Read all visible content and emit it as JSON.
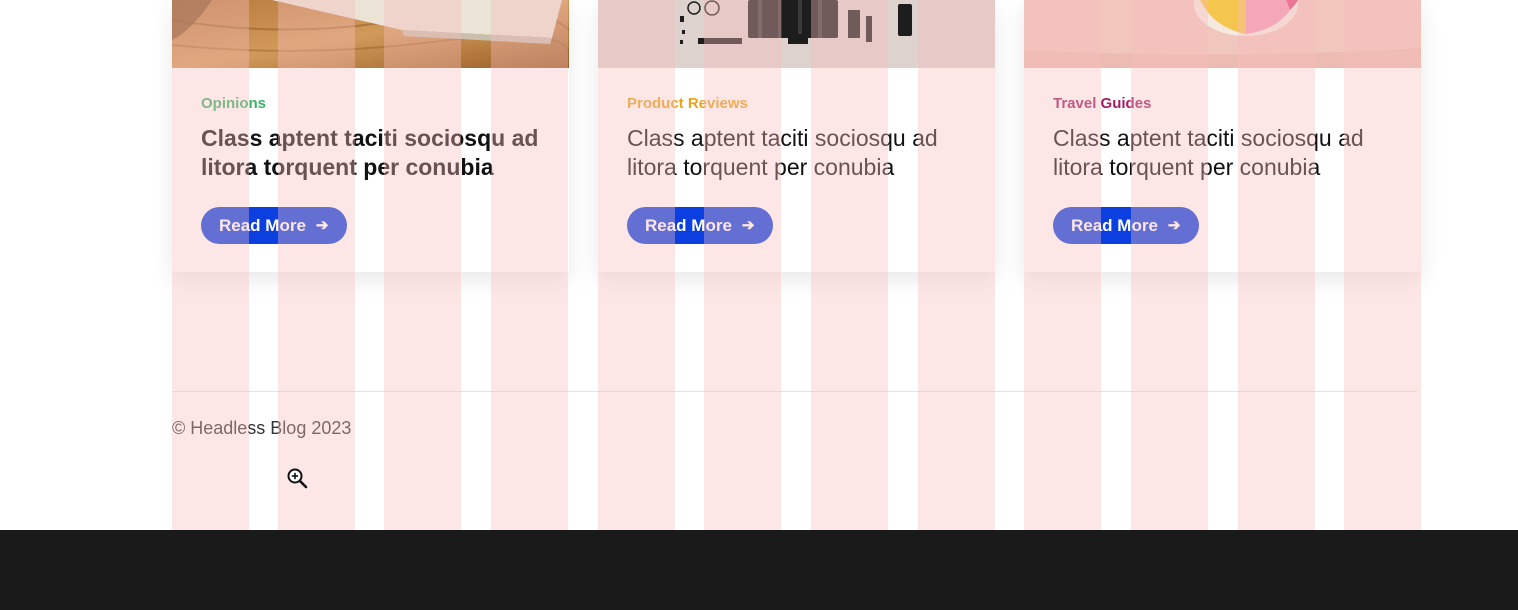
{
  "cards": [
    {
      "category": "Opinions",
      "category_color": "#3bb46b",
      "title": "Class aptent taciti sociosqu ad litora torquent per conubia",
      "title_bold": true,
      "image": "wooden-table-book-photo",
      "button_label": "Read More",
      "button_icon": "arrow-right-icon"
    },
    {
      "category": "Product Reviews",
      "category_color": "#e9a31d",
      "title": "Class aptent taciti sociosqu ad litora torquent per conubia",
      "title_bold": false,
      "image": "tech-gadgets-flatlay-photo",
      "button_label": "Read More",
      "button_icon": "arrow-right-icon"
    },
    {
      "category": "Travel Guides",
      "category_color": "#a61c63",
      "title": "Class aptent taciti sociosqu ad litora torquent per conubia",
      "title_bold": false,
      "image": "beach-ball-photo",
      "button_label": "Read More",
      "button_icon": "arrow-right-icon"
    }
  ],
  "footer": {
    "copyright": "© Headless Blog 2023"
  },
  "colors": {
    "button": "#0b3fe0",
    "grid_overlay": "#f8bebe",
    "bottom_bar": "#1a1a1a"
  },
  "cursor": "zoom-in-icon"
}
